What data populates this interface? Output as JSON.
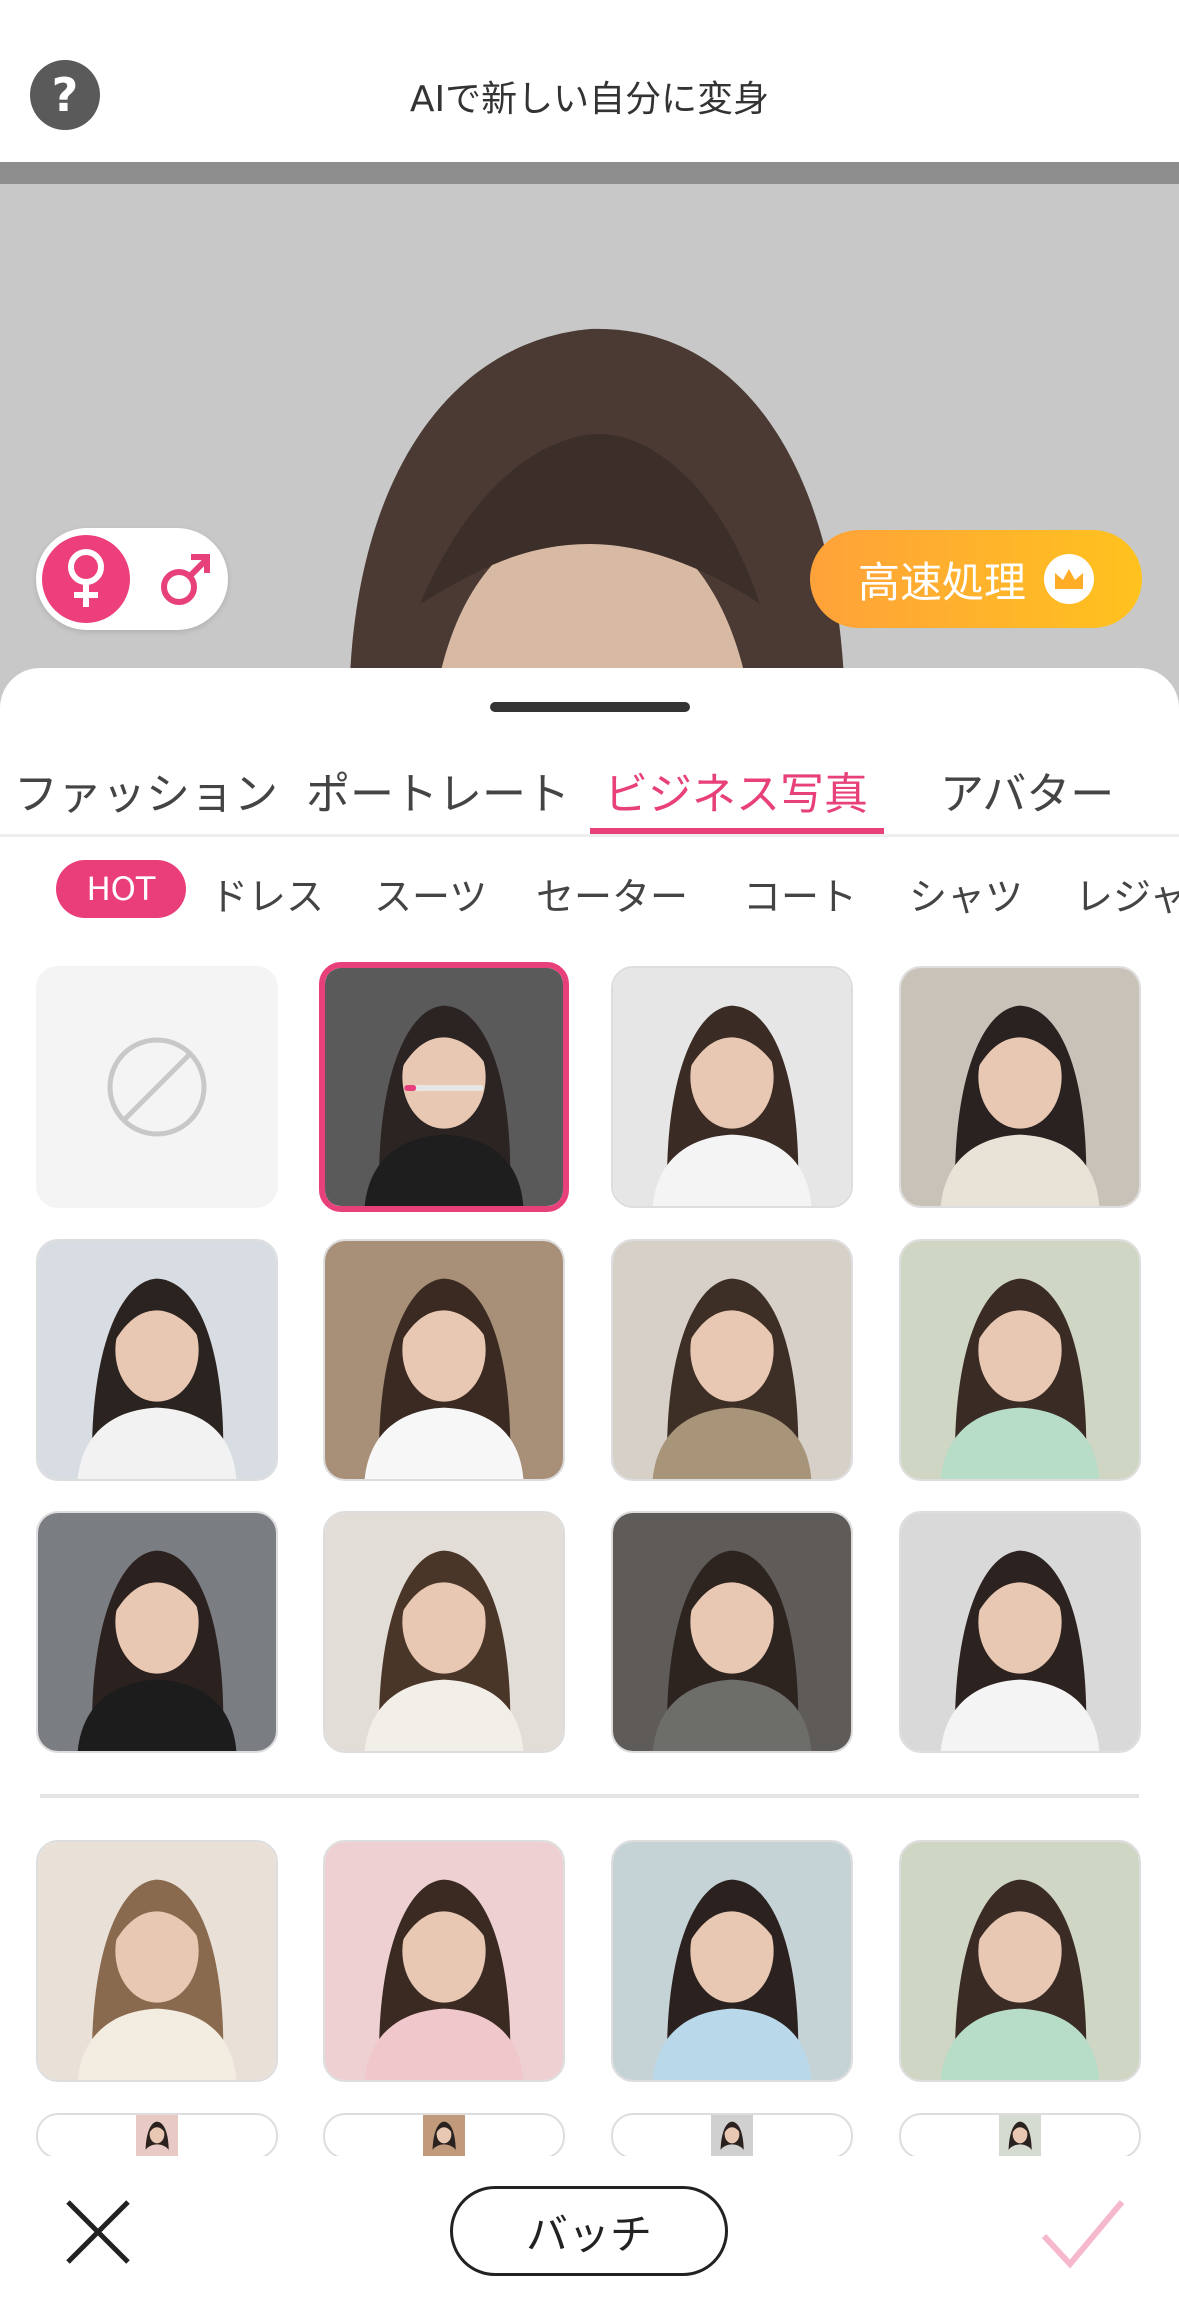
{
  "header": {
    "title": "AIで新しい自分に変身",
    "help_icon": "?"
  },
  "preview": {
    "gender": {
      "female": "♀",
      "male": "♂",
      "selected": "female"
    },
    "fast_button": "高速処理"
  },
  "categories": [
    "ファッション",
    "ポートレート",
    "ビジネス写真",
    "アバター"
  ],
  "active_category": "ビジネス写真",
  "subcategories": [
    "HOT",
    "ドレス",
    "スーツ",
    "セーター",
    "コート",
    "シャツ",
    "レジャ"
  ],
  "colors": {
    "accent": "#e8407b",
    "fast": "#ffb02a"
  },
  "footer": {
    "batch_label": "バッチ"
  }
}
